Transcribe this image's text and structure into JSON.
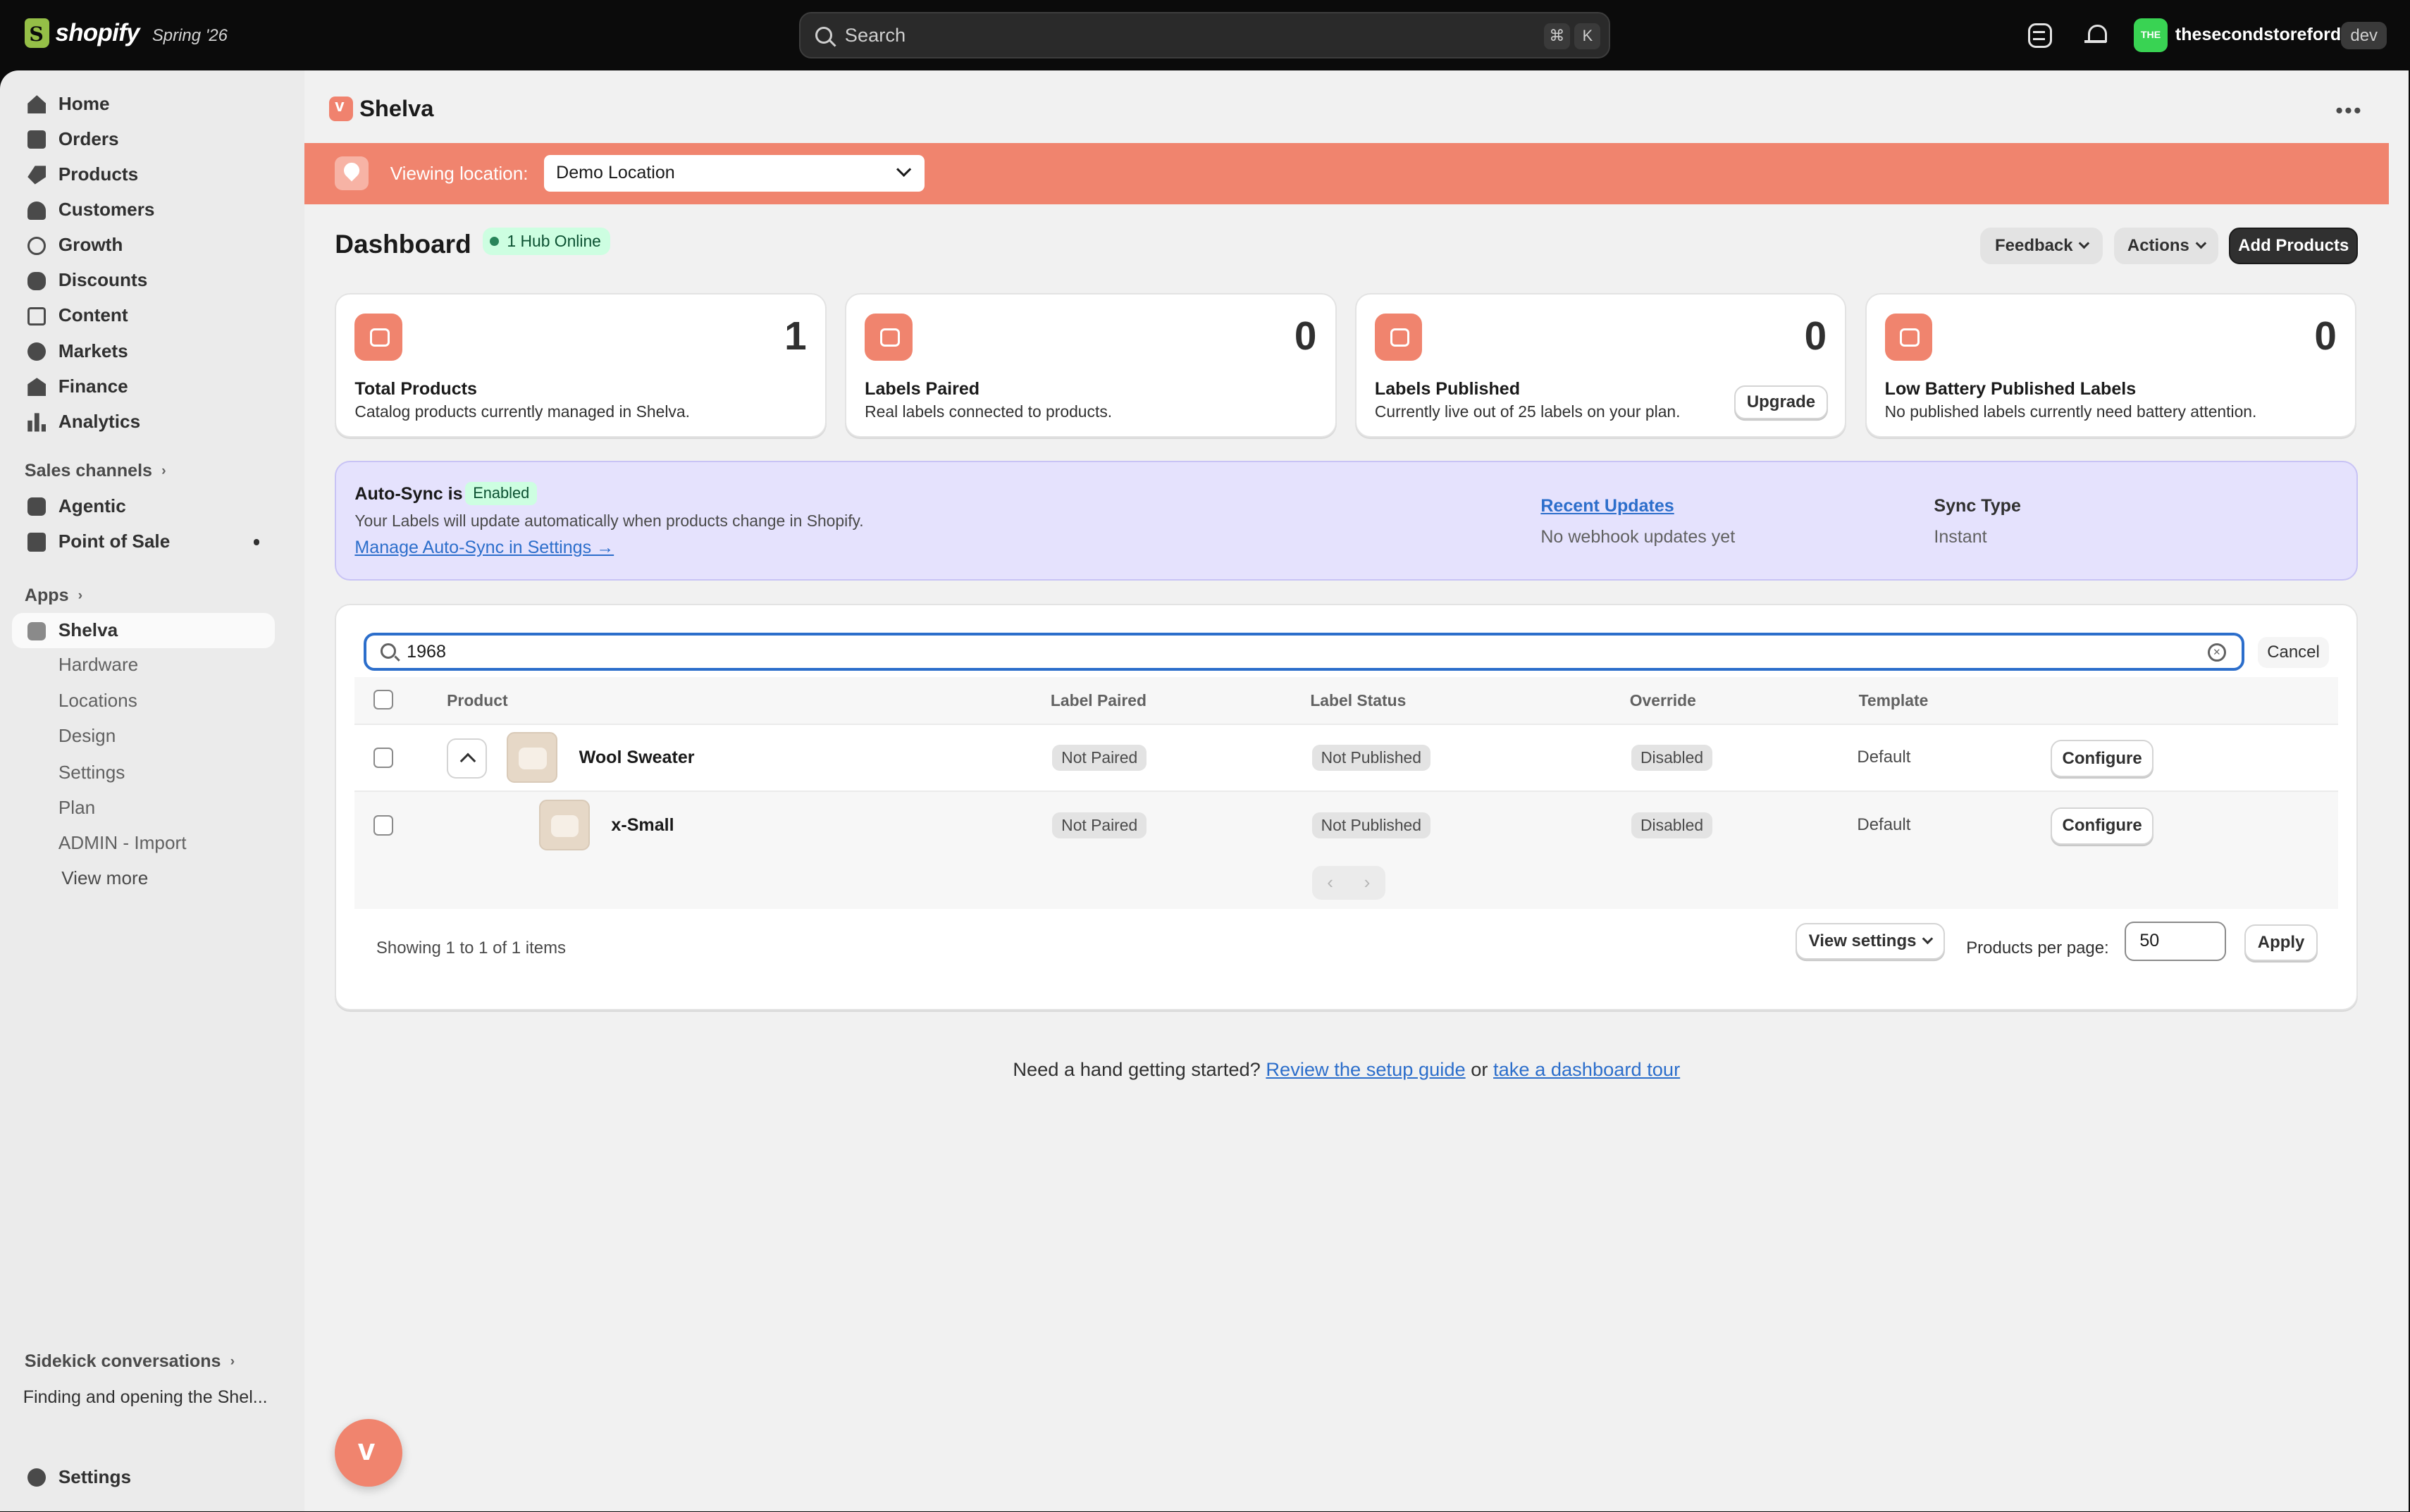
{
  "topbar": {
    "brand": "shopify",
    "edition": "Spring '26",
    "search_placeholder": "Search",
    "shortcut_cmd": "⌘",
    "shortcut_key": "K",
    "store_avatar": "THE",
    "store_name": "thesecondstorefordev",
    "store_badge": "dev"
  },
  "sidebar": {
    "items": [
      {
        "label": "Home",
        "icon": "home-icon"
      },
      {
        "label": "Orders",
        "icon": "orders-icon"
      },
      {
        "label": "Products",
        "icon": "tag-icon"
      },
      {
        "label": "Customers",
        "icon": "person-icon"
      },
      {
        "label": "Growth",
        "icon": "growth-icon"
      },
      {
        "label": "Discounts",
        "icon": "discount-icon"
      },
      {
        "label": "Content",
        "icon": "content-icon"
      },
      {
        "label": "Markets",
        "icon": "globe-icon"
      },
      {
        "label": "Finance",
        "icon": "bank-icon"
      },
      {
        "label": "Analytics",
        "icon": "bar-chart-icon"
      }
    ],
    "sales_channels_header": "Sales channels",
    "sales_channels": [
      {
        "label": "Agentic"
      },
      {
        "label": "Point of Sale"
      }
    ],
    "apps_header": "Apps",
    "app_active": "Shelva",
    "app_sub": [
      "Hardware",
      "Locations",
      "Design",
      "Settings",
      "Plan",
      "ADMIN - Import"
    ],
    "view_more": "View more",
    "sidekick_header": "Sidekick conversations",
    "sidekick_item": "Finding and opening the Shel...",
    "settings": "Settings"
  },
  "main": {
    "app_title": "Shelva",
    "location_label": "Viewing location:",
    "location_value": "Demo Location",
    "dashboard_title": "Dashboard",
    "hub_status": "1 Hub Online",
    "buttons": {
      "feedback": "Feedback",
      "actions": "Actions",
      "add_products": "Add Products"
    },
    "stats": [
      {
        "value": "1",
        "label": "Total Products",
        "desc": "Catalog products currently managed in Shelva."
      },
      {
        "value": "0",
        "label": "Labels Paired",
        "desc": "Real labels connected to products."
      },
      {
        "value": "0",
        "label": "Labels Published",
        "desc": "Currently live out of 25 labels on your plan.",
        "action": "Upgrade"
      },
      {
        "value": "0",
        "label": "Low Battery Published Labels",
        "desc": "No published labels currently need battery attention."
      }
    ],
    "autosync": {
      "title": "Auto-Sync is",
      "status": "Enabled",
      "desc": "Your Labels will update automatically when products change in Shopify.",
      "link": "Manage Auto-Sync in Settings →",
      "recent_title": "Recent Updates",
      "recent_desc": "No webhook updates yet",
      "sync_type_title": "Sync Type",
      "sync_type_value": "Instant"
    },
    "table": {
      "search_value": "1968",
      "cancel": "Cancel",
      "columns": [
        "Product",
        "Label Paired",
        "Label Status",
        "Override",
        "Template"
      ],
      "rows": [
        {
          "name": "Wool Sweater",
          "label_paired": "Not Paired",
          "label_status": "Not Published",
          "override": "Disabled",
          "template": "Default",
          "action": "Configure"
        },
        {
          "name": "x-Small",
          "label_paired": "Not Paired",
          "label_status": "Not Published",
          "override": "Disabled",
          "template": "Default",
          "action": "Configure"
        }
      ],
      "pager_prev": "‹",
      "pager_next": "›",
      "showing": "Showing 1 to 1 of 1 items",
      "view_settings": "View settings",
      "per_page_label": "Products per page:",
      "per_page_value": "50",
      "apply": "Apply"
    },
    "help": {
      "prefix": "Need a hand getting started?",
      "link1": "Review the setup guide",
      "middle": "or",
      "link2": "take a dashboard tour"
    }
  },
  "colors": {
    "accent": "#f0846e",
    "sync_bg": "#e5e2fd",
    "link": "#2c6ecb",
    "success_bg": "#cdfee1"
  }
}
